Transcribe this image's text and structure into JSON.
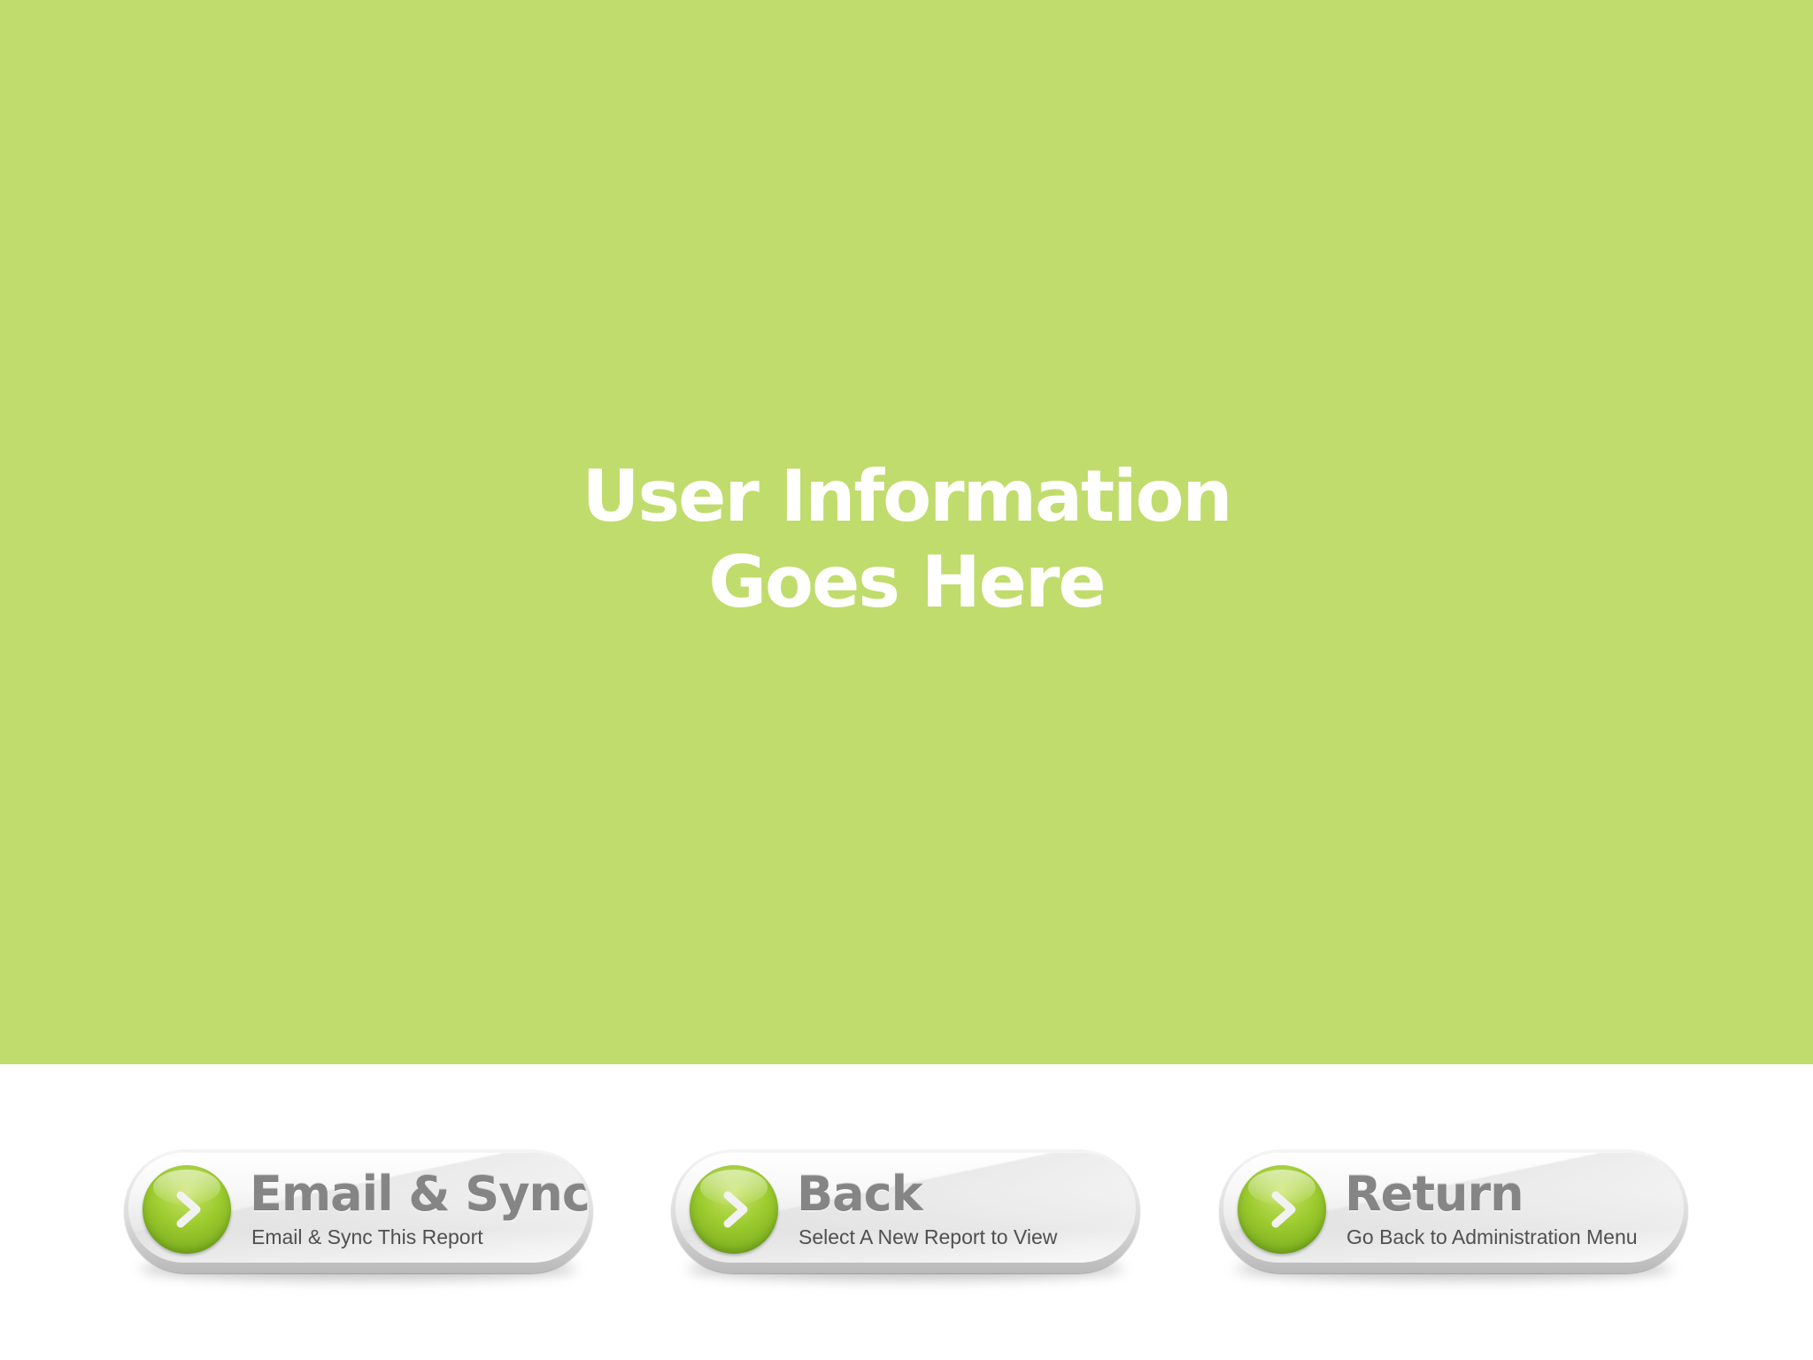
{
  "info_panel": {
    "line1": "User Information",
    "line2": "Goes Here",
    "background_color": "#c0dc6c",
    "text_color": "#ffffff"
  },
  "buttons": [
    {
      "label": "Email & Sync",
      "sublabel": "Email & Sync This Report",
      "icon": "chevron-right-icon"
    },
    {
      "label": "Back",
      "sublabel": "Select A New Report to View",
      "icon": "chevron-right-icon"
    },
    {
      "label": "Return",
      "sublabel": "Go Back to Administration Menu",
      "icon": "chevron-right-icon"
    }
  ],
  "accent_color": "#8cc63f"
}
